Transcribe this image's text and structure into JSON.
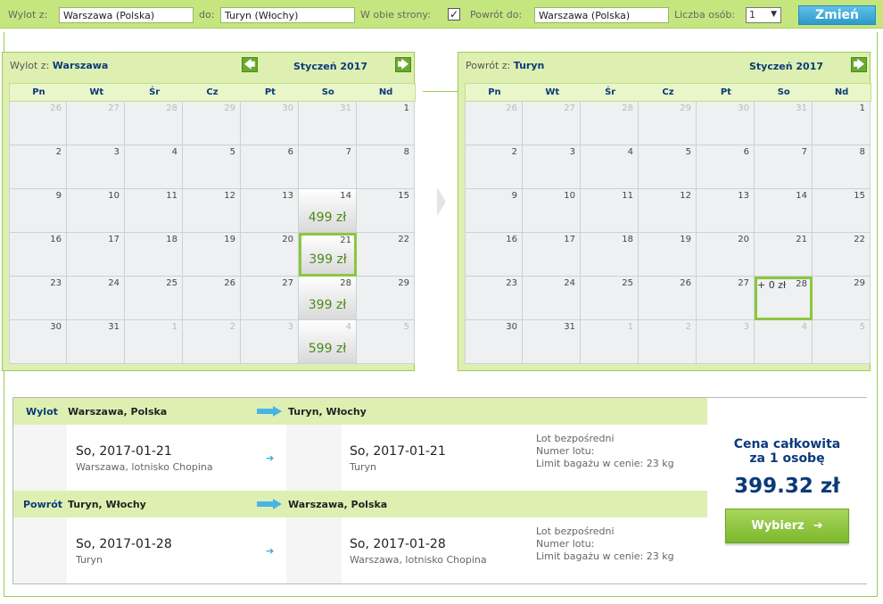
{
  "search": {
    "from_label": "Wylot z:",
    "from_value": "Warszawa (Polska)",
    "to_label": "do:",
    "to_value": "Turyn (Włochy)",
    "roundtrip_label": "W obie strony:",
    "roundtrip_checked": "✓",
    "return_label": "Powrót do:",
    "return_value": "Warszawa (Polska)",
    "persons_label": "Liczba osób:",
    "persons_value": "1",
    "submit_label": "Zmień"
  },
  "weekdays": [
    "Pn",
    "Wt",
    "Śr",
    "Cz",
    "Pt",
    "So",
    "Nd"
  ],
  "outbound": {
    "title_prefix": "Wylot z:",
    "title_city": "Warszawa",
    "month": "Styczeń 2017",
    "weeks": [
      [
        {
          "d": "26",
          "dim": true
        },
        {
          "d": "27",
          "dim": true
        },
        {
          "d": "28",
          "dim": true
        },
        {
          "d": "29",
          "dim": true
        },
        {
          "d": "30",
          "dim": true
        },
        {
          "d": "31",
          "dim": true
        },
        {
          "d": "1"
        }
      ],
      [
        {
          "d": "2"
        },
        {
          "d": "3"
        },
        {
          "d": "4"
        },
        {
          "d": "5"
        },
        {
          "d": "6"
        },
        {
          "d": "7"
        },
        {
          "d": "8"
        }
      ],
      [
        {
          "d": "9"
        },
        {
          "d": "10"
        },
        {
          "d": "11"
        },
        {
          "d": "12"
        },
        {
          "d": "13"
        },
        {
          "d": "14",
          "price": "499 zł"
        },
        {
          "d": "15"
        }
      ],
      [
        {
          "d": "16"
        },
        {
          "d": "17"
        },
        {
          "d": "18"
        },
        {
          "d": "19"
        },
        {
          "d": "20"
        },
        {
          "d": "21",
          "price": "399 zł",
          "selected": true
        },
        {
          "d": "22"
        }
      ],
      [
        {
          "d": "23"
        },
        {
          "d": "24"
        },
        {
          "d": "25"
        },
        {
          "d": "26"
        },
        {
          "d": "27"
        },
        {
          "d": "28",
          "price": "399 zł"
        },
        {
          "d": "29"
        }
      ],
      [
        {
          "d": "30"
        },
        {
          "d": "31"
        },
        {
          "d": "1",
          "dim": true
        },
        {
          "d": "2",
          "dim": true
        },
        {
          "d": "3",
          "dim": true
        },
        {
          "d": "4",
          "dim": true,
          "price": "599 zł"
        },
        {
          "d": "5",
          "dim": true
        }
      ]
    ]
  },
  "return": {
    "title_prefix": "Powrót z:",
    "title_city": "Turyn",
    "month": "Styczeń 2017",
    "weeks": [
      [
        {
          "d": "26",
          "dim": true
        },
        {
          "d": "27",
          "dim": true
        },
        {
          "d": "28",
          "dim": true
        },
        {
          "d": "29",
          "dim": true
        },
        {
          "d": "30",
          "dim": true
        },
        {
          "d": "31",
          "dim": true
        },
        {
          "d": "1"
        }
      ],
      [
        {
          "d": "2"
        },
        {
          "d": "3"
        },
        {
          "d": "4"
        },
        {
          "d": "5"
        },
        {
          "d": "6"
        },
        {
          "d": "7"
        },
        {
          "d": "8"
        }
      ],
      [
        {
          "d": "9"
        },
        {
          "d": "10"
        },
        {
          "d": "11"
        },
        {
          "d": "12"
        },
        {
          "d": "13"
        },
        {
          "d": "14"
        },
        {
          "d": "15"
        }
      ],
      [
        {
          "d": "16"
        },
        {
          "d": "17"
        },
        {
          "d": "18"
        },
        {
          "d": "19"
        },
        {
          "d": "20"
        },
        {
          "d": "21"
        },
        {
          "d": "22"
        }
      ],
      [
        {
          "d": "23"
        },
        {
          "d": "24"
        },
        {
          "d": "25"
        },
        {
          "d": "26"
        },
        {
          "d": "27"
        },
        {
          "d": "28",
          "price": "+ 0 zł",
          "selected": true,
          "plain": true
        },
        {
          "d": "29"
        }
      ],
      [
        {
          "d": "30"
        },
        {
          "d": "31"
        },
        {
          "d": "1",
          "dim": true
        },
        {
          "d": "2",
          "dim": true
        },
        {
          "d": "3",
          "dim": true
        },
        {
          "d": "4",
          "dim": true
        },
        {
          "d": "5",
          "dim": true
        }
      ]
    ]
  },
  "summary": {
    "outbound": {
      "label": "Wylot",
      "from": "Warszawa, Polska",
      "to": "Turyn, Włochy",
      "dep_day": "So,",
      "dep_date": "2017-01-21",
      "dep_place": "Warszawa, lotnisko Chopina",
      "arr_day": "So,",
      "arr_date": "2017-01-21",
      "arr_place": "Turyn",
      "info_1": "Lot bezpośredni",
      "info_2": "Numer lotu:",
      "info_3": "Limit bagażu w cenie: 23 kg"
    },
    "inbound": {
      "label": "Powrót",
      "from": "Turyn, Włochy",
      "to": "Warszawa, Polska",
      "dep_day": "So,",
      "dep_date": "2017-01-28",
      "dep_place": "Turyn",
      "arr_day": "So,",
      "arr_date": "2017-01-28",
      "arr_place": "Warszawa, lotnisko Chopina",
      "info_1": "Lot bezpośredni",
      "info_2": "Numer lotu:",
      "info_3": "Limit bagażu w cenie: 23 kg"
    },
    "price_title_1": "Cena całkowita",
    "price_title_2": "za 1 osobę",
    "price_value": "399.32 zł",
    "choose_label": "Wybierz"
  },
  "colors": {
    "bar_green": "#c5e67f",
    "calendar_bg": "#def0b1",
    "price_green": "#4b8a19",
    "navy": "#0a3a7a",
    "button_blue": "#2e99c9"
  }
}
